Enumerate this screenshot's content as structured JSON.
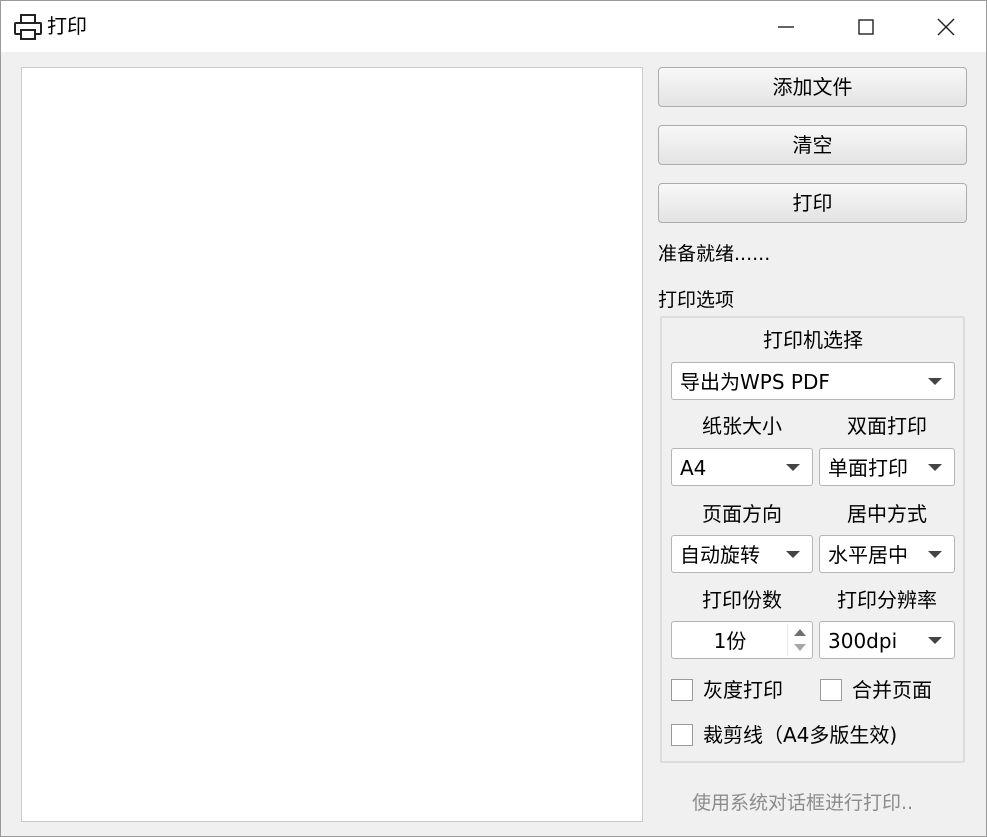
{
  "window": {
    "title": "打印"
  },
  "buttons": {
    "add_file": "添加文件",
    "clear": "清空",
    "print": "打印"
  },
  "status": "准备就绪......",
  "options": {
    "title": "打印选项",
    "printer_label": "打印机选择",
    "printer_value": "导出为WPS PDF",
    "paper_size_label": "纸张大小",
    "paper_size_value": "A4",
    "duplex_label": "双面打印",
    "duplex_value": "单面打印",
    "orientation_label": "页面方向",
    "orientation_value": "自动旋转",
    "center_label": "居中方式",
    "center_value": "水平居中",
    "copies_label": "打印份数",
    "copies_value": "1份",
    "resolution_label": "打印分辨率",
    "resolution_value": "300dpi",
    "grayscale": {
      "label": "灰度打印",
      "checked": false
    },
    "merge_pages": {
      "label": "合并页面",
      "checked": false
    },
    "crop_marks": {
      "label": "裁剪线（A4多版生效)",
      "checked": false
    }
  },
  "system_dialog_link": "使用系统对话框进行打印.."
}
